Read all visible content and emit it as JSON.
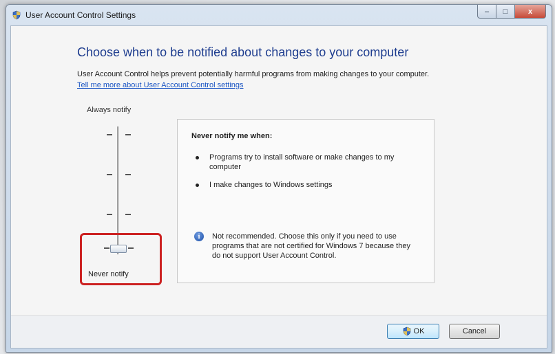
{
  "window": {
    "title": "User Account Control Settings",
    "caption_min": "–",
    "caption_max": "□",
    "caption_close": "x"
  },
  "main": {
    "heading": "Choose when to be notified about changes to your computer",
    "description": "User Account Control helps prevent potentially harmful programs from making changes to your computer.",
    "link": "Tell me more about User Account Control settings"
  },
  "slider": {
    "top_label": "Always notify",
    "bottom_label": "Never notify",
    "levels": 4,
    "selected_level": 1,
    "selected_label": "Never notify"
  },
  "info": {
    "title": "Never notify me when:",
    "bullets": [
      "Programs try to install software or make changes to my computer",
      "I make changes to Windows settings"
    ],
    "warning": "Not recommended. Choose this only if you need to use programs that are not certified for Windows 7 because they do not support User Account Control.",
    "warning_icon": "i"
  },
  "buttons": {
    "ok": "OK",
    "cancel": "Cancel"
  },
  "colors": {
    "heading": "#1e3d8f",
    "link": "#1c56c4",
    "highlight": "#cc2222"
  }
}
